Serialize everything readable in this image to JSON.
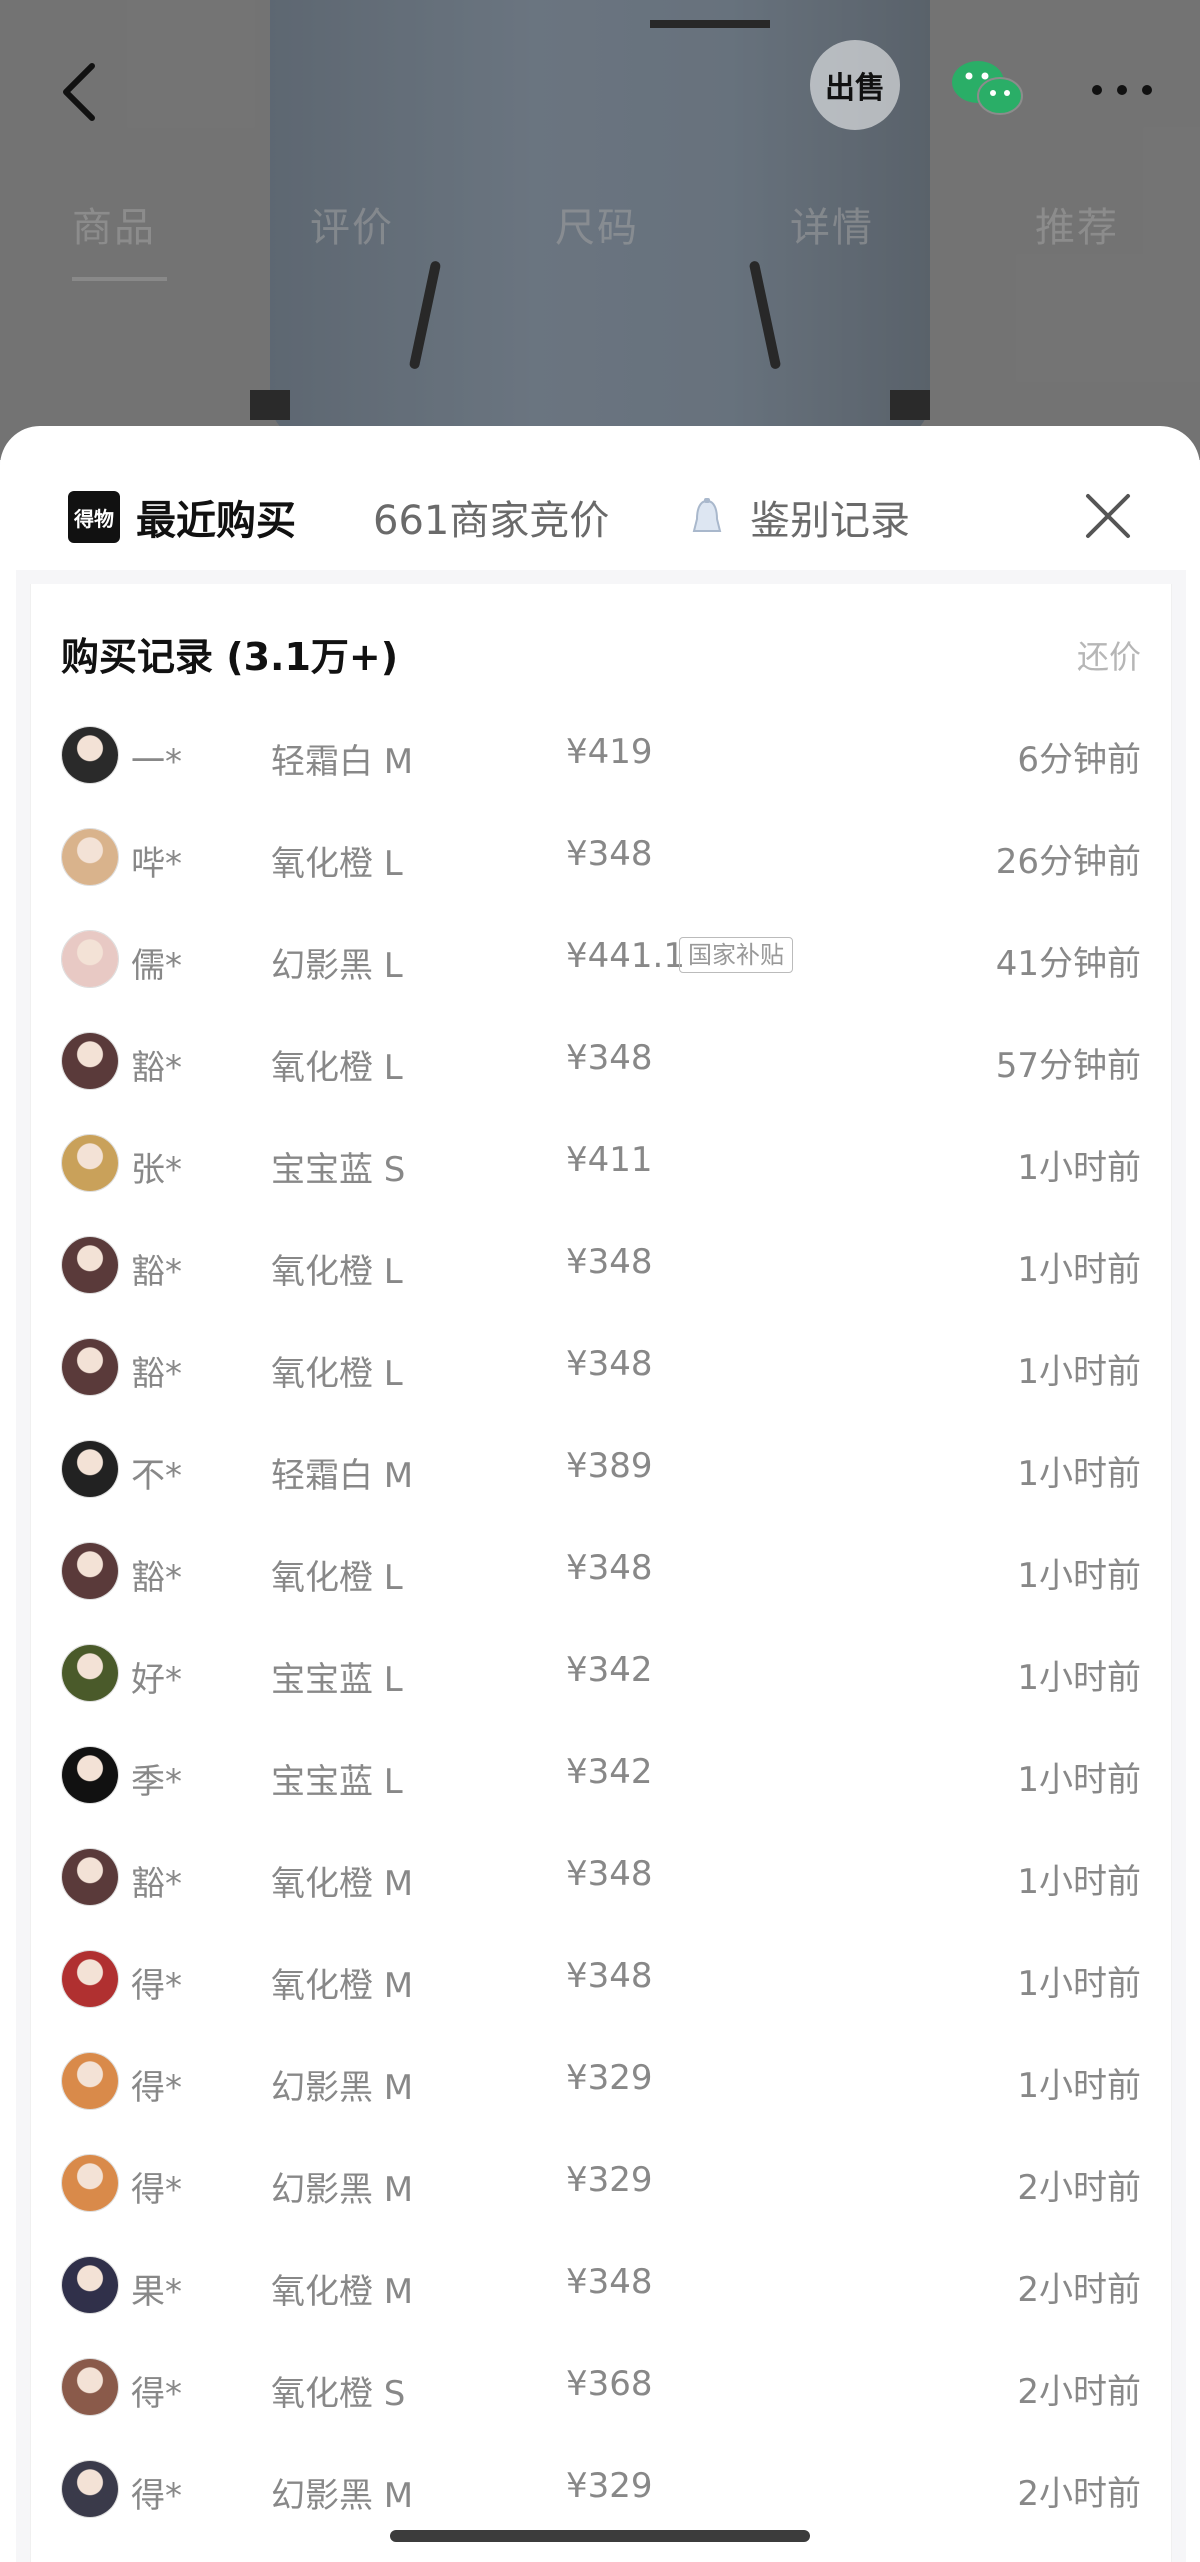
{
  "product_tabs": [
    "商品",
    "评价",
    "尺码",
    "详情",
    "推荐"
  ],
  "top_actions": {
    "sell_label": "出售"
  },
  "sheet": {
    "tabs": [
      {
        "label": "最近购买",
        "logo_text": "得物",
        "active": true
      },
      {
        "label": "661商家竞价",
        "active": false
      },
      {
        "label": "鉴别记录",
        "active": false
      }
    ],
    "list_title": "购买记录 (3.1万+)",
    "counter_offer_label": "还价"
  },
  "purchases": [
    {
      "user": "一*",
      "spec": "轻霜白 M",
      "price": "¥419",
      "badge": "",
      "time": "6分钟前",
      "avatar_color": "#2a2a2a"
    },
    {
      "user": "哔*",
      "spec": "氧化橙 L",
      "price": "¥348",
      "badge": "",
      "time": "26分钟前",
      "avatar_color": "#d9b38c"
    },
    {
      "user": "儒*",
      "spec": "幻影黑 L",
      "price": "¥441.1",
      "badge": "国家补贴",
      "time": "41分钟前",
      "avatar_color": "#e8c9c4"
    },
    {
      "user": "豁*",
      "spec": "氧化橙 L",
      "price": "¥348",
      "badge": "",
      "time": "57分钟前",
      "avatar_color": "#5a3a3a"
    },
    {
      "user": "张*",
      "spec": "宝宝蓝 S",
      "price": "¥411",
      "badge": "",
      "time": "1小时前",
      "avatar_color": "#c9a15a"
    },
    {
      "user": "豁*",
      "spec": "氧化橙 L",
      "price": "¥348",
      "badge": "",
      "time": "1小时前",
      "avatar_color": "#5a3a3a"
    },
    {
      "user": "豁*",
      "spec": "氧化橙 L",
      "price": "¥348",
      "badge": "",
      "time": "1小时前",
      "avatar_color": "#5a3a3a"
    },
    {
      "user": "不*",
      "spec": "轻霜白 M",
      "price": "¥389",
      "badge": "",
      "time": "1小时前",
      "avatar_color": "#222222"
    },
    {
      "user": "豁*",
      "spec": "氧化橙 L",
      "price": "¥348",
      "badge": "",
      "time": "1小时前",
      "avatar_color": "#5a3a3a"
    },
    {
      "user": "好*",
      "spec": "宝宝蓝 L",
      "price": "¥342",
      "badge": "",
      "time": "1小时前",
      "avatar_color": "#4a5a2a"
    },
    {
      "user": "季*",
      "spec": "宝宝蓝 L",
      "price": "¥342",
      "badge": "",
      "time": "1小时前",
      "avatar_color": "#111111"
    },
    {
      "user": "豁*",
      "spec": "氧化橙 M",
      "price": "¥348",
      "badge": "",
      "time": "1小时前",
      "avatar_color": "#5a3a3a"
    },
    {
      "user": "得*",
      "spec": "氧化橙 M",
      "price": "¥348",
      "badge": "",
      "time": "1小时前",
      "avatar_color": "#b03030"
    },
    {
      "user": "得*",
      "spec": "幻影黑 M",
      "price": "¥329",
      "badge": "",
      "time": "1小时前",
      "avatar_color": "#d98a4a"
    },
    {
      "user": "得*",
      "spec": "幻影黑 M",
      "price": "¥329",
      "badge": "",
      "time": "2小时前",
      "avatar_color": "#d98a4a"
    },
    {
      "user": "果*",
      "spec": "氧化橙 M",
      "price": "¥348",
      "badge": "",
      "time": "2小时前",
      "avatar_color": "#30304a"
    },
    {
      "user": "得*",
      "spec": "氧化橙 S",
      "price": "¥368",
      "badge": "",
      "time": "2小时前",
      "avatar_color": "#8a5a4a"
    },
    {
      "user": "得*",
      "spec": "幻影黑 M",
      "price": "¥329",
      "badge": "",
      "time": "2小时前",
      "avatar_color": "#3a3a4a"
    }
  ]
}
